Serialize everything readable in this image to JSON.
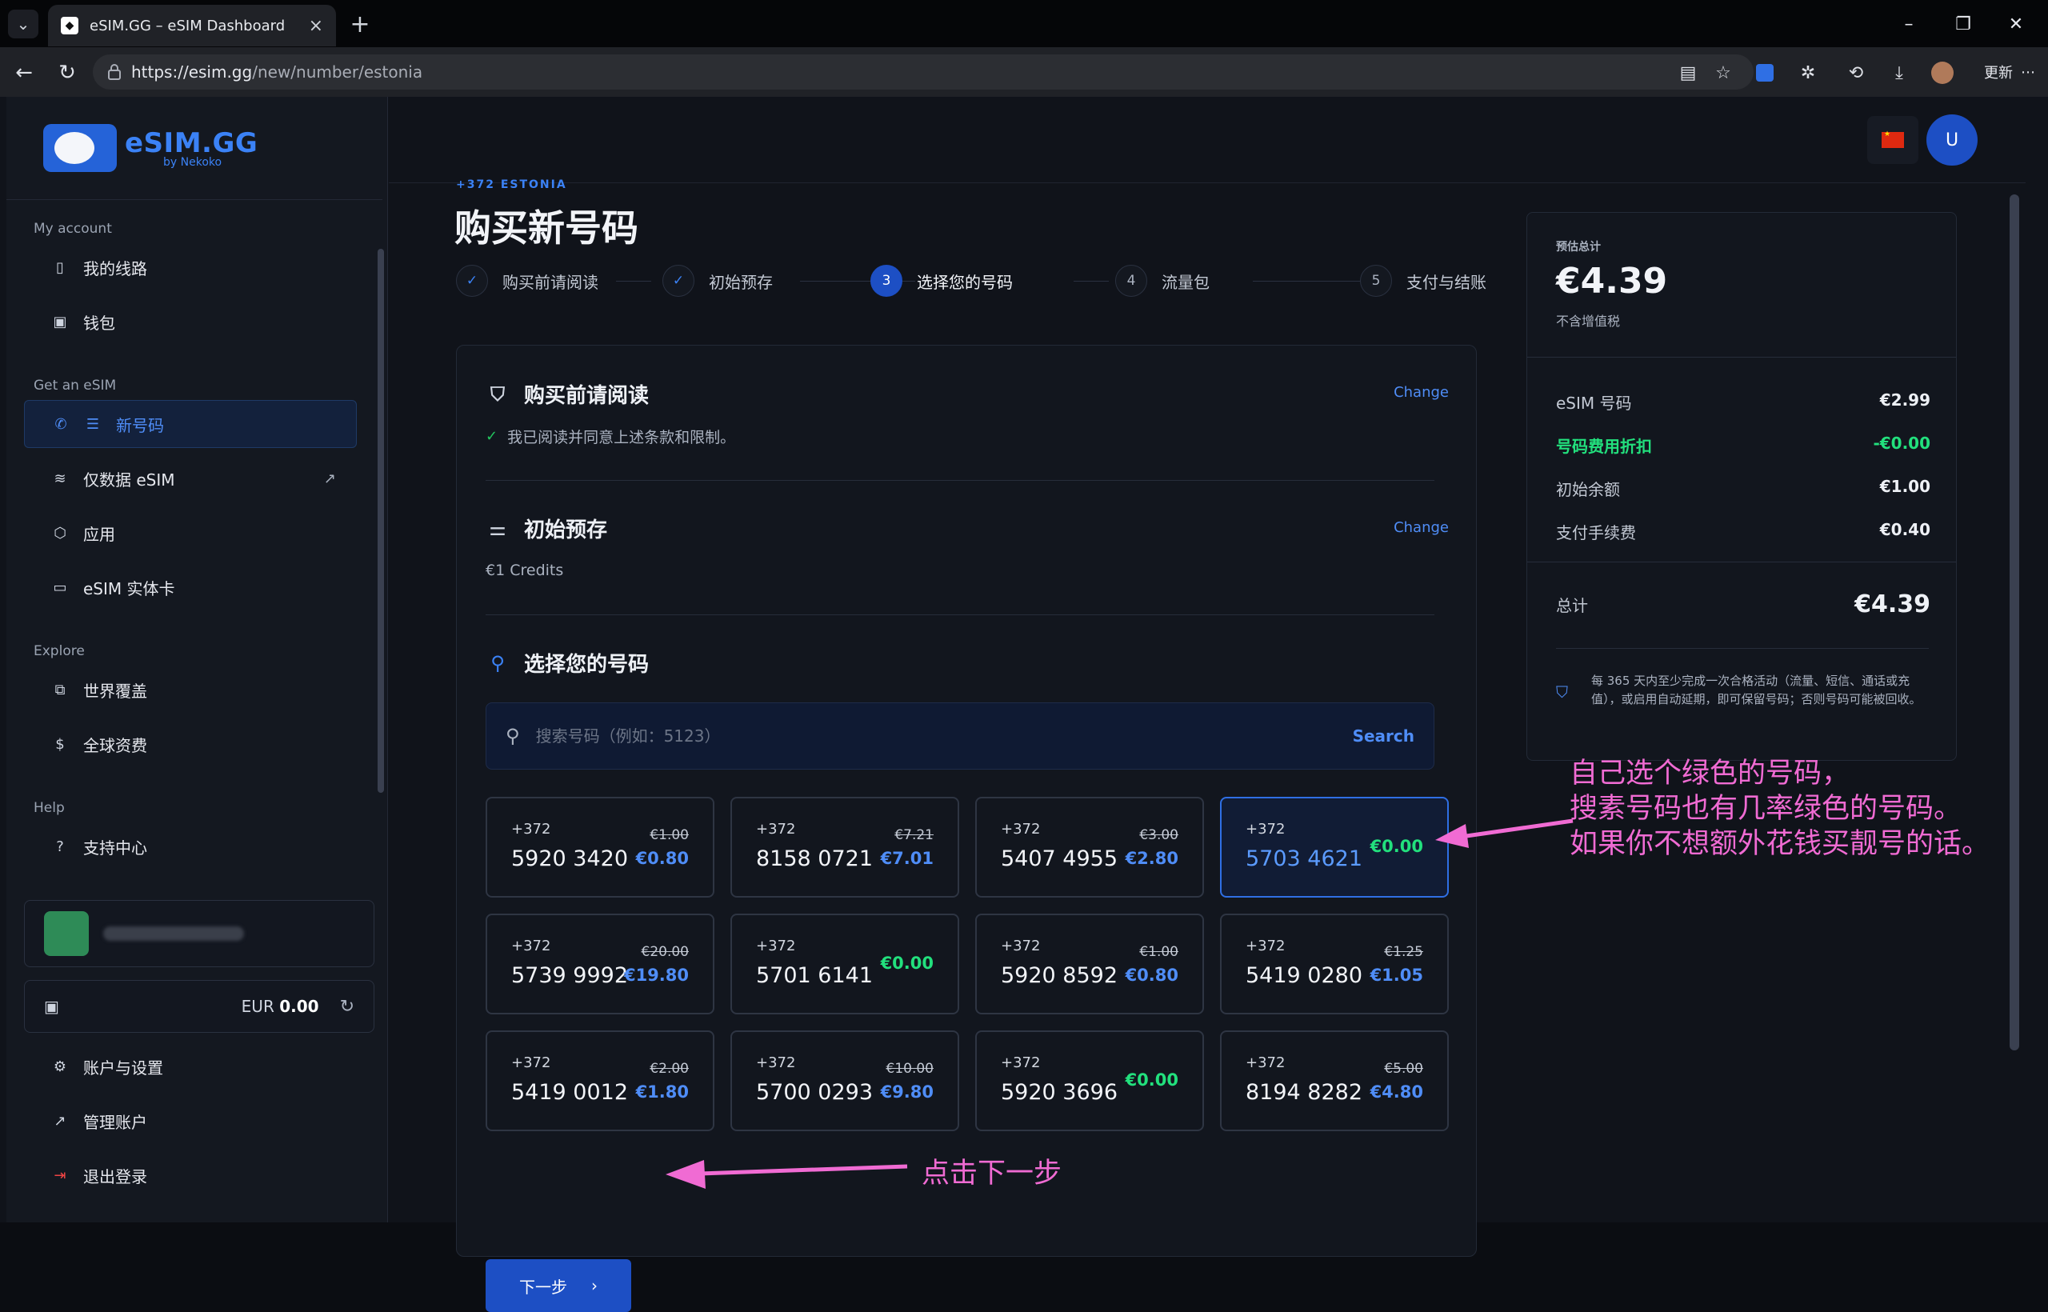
{
  "browser": {
    "tab_title": "eSIM.GG – eSIM Dashboard",
    "url_host": "https://esim.gg",
    "url_path": "/new/number/estonia",
    "update_label": "更新"
  },
  "sidebar": {
    "logo_title": "eSIM.GG",
    "logo_sub": "by Nekoko",
    "sections": {
      "my_account": "My account",
      "get_esim": "Get an eSIM",
      "explore": "Explore",
      "help": "Help"
    },
    "items": {
      "my_lines": "我的线路",
      "wallet": "钱包",
      "new_number": "新号码",
      "data_esim": "仅数据 eSIM",
      "apps": "应用",
      "physical": "eSIM 实体卡",
      "coverage": "世界覆盖",
      "rates": "全球资费",
      "support": "支持中心",
      "settings": "账户与设置",
      "manage": "管理账户",
      "logout": "退出登录"
    },
    "wallet_currency": "EUR",
    "wallet_amount": "0.00"
  },
  "header": {
    "user_initial": "U"
  },
  "page": {
    "eyebrow": "+372 ESTONIA",
    "title": "购买新号码"
  },
  "steps": [
    {
      "label": "购买前请阅读",
      "marker": "✓"
    },
    {
      "label": "初始预存",
      "marker": "✓"
    },
    {
      "label": "选择您的号码",
      "marker": "3"
    },
    {
      "label": "流量包",
      "marker": "4"
    },
    {
      "label": "支付与结账",
      "marker": "5"
    }
  ],
  "sections": {
    "read": {
      "title": "购买前请阅读",
      "change": "Change",
      "text": "我已阅读并同意上述条款和限制。"
    },
    "deposit": {
      "title": "初始预存",
      "change": "Change",
      "text": "€1 Credits"
    },
    "choose": {
      "title": "选择您的号码",
      "search_placeholder": "搜索号码（例如：5123）",
      "search_button": "Search"
    }
  },
  "numbers": [
    {
      "cc": "+372",
      "number": "5920 3420",
      "old": "€1.00",
      "price": "€0.80"
    },
    {
      "cc": "+372",
      "number": "8158 0721",
      "old": "€7.21",
      "price": "€7.01"
    },
    {
      "cc": "+372",
      "number": "5407 4955",
      "old": "€3.00",
      "price": "€2.80"
    },
    {
      "cc": "+372",
      "number": "5703 4621",
      "old": "",
      "price": "€0.00"
    },
    {
      "cc": "+372",
      "number": "5739 9992",
      "old": "€20.00",
      "price": "€19.80"
    },
    {
      "cc": "+372",
      "number": "5701 6141",
      "old": "",
      "price": "€0.00"
    },
    {
      "cc": "+372",
      "number": "5920 8592",
      "old": "€1.00",
      "price": "€0.80"
    },
    {
      "cc": "+372",
      "number": "5419 0280",
      "old": "€1.25",
      "price": "€1.05"
    },
    {
      "cc": "+372",
      "number": "5419 0012",
      "old": "€2.00",
      "price": "€1.80"
    },
    {
      "cc": "+372",
      "number": "5700 0293",
      "old": "€10.00",
      "price": "€9.80"
    },
    {
      "cc": "+372",
      "number": "5920 3696",
      "old": "",
      "price": "€0.00"
    },
    {
      "cc": "+372",
      "number": "8194 8282",
      "old": "€5.00",
      "price": "€4.80"
    }
  ],
  "next_button": "下一步",
  "summary": {
    "label": "预估总计",
    "total": "€4.39",
    "vat_note": "不含增值税",
    "rows": [
      {
        "label": "eSIM 号码",
        "value": "€2.99"
      },
      {
        "label": "号码费用折扣",
        "value": "-€0.00"
      },
      {
        "label": "初始余额",
        "value": "€1.00"
      },
      {
        "label": "支付手续费",
        "value": "€0.40"
      }
    ],
    "total_label": "总计",
    "total_value": "€4.39",
    "note": "每 365 天内至少完成一次合格活动（流量、短信、通话或充值），或启用自动延期，即可保留号码；否则号码可能被回收。"
  },
  "annotations": {
    "line1": "自己选个绿色的号码，",
    "line2": "搜素号码也有几率绿色的号码。",
    "line3": "如果你不想额外花钱买靓号的话。",
    "next_hint": "点击下一步"
  },
  "colors": {
    "accent": "#3b82f6",
    "free_price": "#22e07d",
    "annotation": "#f06bd3"
  }
}
